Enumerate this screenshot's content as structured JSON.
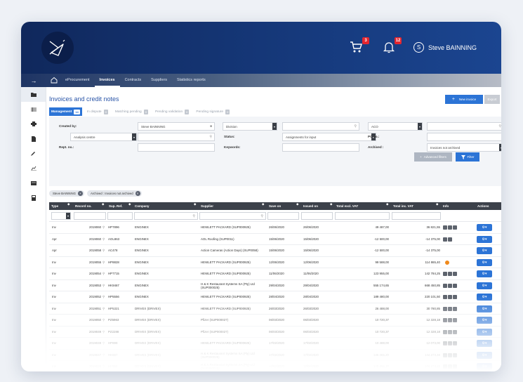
{
  "header": {
    "cart_badge": "3",
    "bell_badge": "12",
    "user_initial": "S",
    "user_name": "Steve BAINNING"
  },
  "nav": {
    "items": [
      {
        "label": "eProcurement",
        "active": false
      },
      {
        "label": "Invoices",
        "active": true
      },
      {
        "label": "Contracts",
        "active": false
      },
      {
        "label": "Suppliers",
        "active": false
      },
      {
        "label": "Statistics reports",
        "active": false
      }
    ]
  },
  "page": {
    "title": "Invoices and credit notes",
    "new_invoice_label": "New invoice",
    "export_label": "Export"
  },
  "tabs": [
    {
      "label": "Management",
      "count": "14",
      "active": true
    },
    {
      "label": "In dispute",
      "count": "0",
      "active": false
    },
    {
      "label": "Matching pending",
      "count": "0",
      "active": false
    },
    {
      "label": "Pending validation",
      "count": "0",
      "active": false
    },
    {
      "label": "Pending signature",
      "count": "0",
      "active": false
    }
  ],
  "filters": {
    "created_by_label": "Created by:",
    "created_by_value": "Steve BAINNING",
    "division_placeholder": "Division",
    "aco_value": "ACO",
    "analysis_centre_placeholder": "Analysis centre",
    "status_label": "Status:",
    "status_value": "Assignments for input",
    "po_label": "PO no.:",
    "rept_label": "Rept. no.:",
    "keywords_label": "Keywords:",
    "archived_label": "Archived :",
    "archived_value": "Invoices not archived",
    "advanced_label": "Advanced filters",
    "filter_label": "Filter"
  },
  "chips": [
    {
      "label": "Steve BAINNING"
    },
    {
      "label": "Archived : Invoices not archived"
    }
  ],
  "table": {
    "headers": {
      "type": "Type",
      "record": "Record no.",
      "sup_ref": "Sup. Ref.",
      "company": "Company",
      "supplier": "Supplier",
      "save_on": "Save on",
      "issued_on": "Issued on",
      "total_excl": "Total excl. VAT",
      "total_inc": "Total inc. VAT",
      "info": "Info",
      "actions": "Actions"
    },
    "rows": [
      {
        "type": "Inv",
        "record": "2019060",
        "sup_ref": "HP7896",
        "company": "ENGINEX",
        "supplier": "HEWLETT PACKARD (SUP000925)",
        "supplier2": "",
        "save_on": "26/06/2020",
        "issued_on": "26/06/2020",
        "total_excl": "49 487,00",
        "total_inc": "36 821,55",
        "info": "boxes3"
      },
      {
        "type": "Apr",
        "record": "2019060",
        "sup_ref": "AOL863",
        "company": "ENGINEX",
        "supplier": "AOL Roofing (SUP0011)",
        "supplier2": "",
        "save_on": "15/06/2020",
        "issued_on": "15/06/2020",
        "total_excl": "-12 500,00",
        "total_inc": "-14 375,00",
        "info": "boxes2"
      },
      {
        "type": "Apr",
        "record": "2019058",
        "sup_ref": "AC478",
        "company": "ENGINEX",
        "supplier": "Action Cameras (Action Days) (SUP0058)",
        "supplier2": "",
        "save_on": "15/06/2020",
        "issued_on": "15/06/2020",
        "total_excl": "-12 500,00",
        "total_inc": "-14 375,00",
        "info": "none"
      },
      {
        "type": "Inv",
        "record": "2019055",
        "sup_ref": "HP8828",
        "company": "ENGINEX",
        "supplier": "HEWLETT PACKARD (SUP000925)",
        "supplier2": "",
        "save_on": "12/06/2020",
        "issued_on": "12/06/2020",
        "total_excl": "99 588,00",
        "total_inc": "114 865,40",
        "info": "dot"
      },
      {
        "type": "Inv",
        "record": "2019054",
        "sup_ref": "HP7715",
        "company": "ENGINEX",
        "supplier": "HEWLETT PACKARD (SUP000925)",
        "supplier2": "",
        "save_on": "11/06/2020",
        "issued_on": "11/06/2020",
        "total_excl": "123 955,00",
        "total_inc": "142 784,25",
        "info": "boxes3"
      },
      {
        "type": "Inv",
        "record": "2019053",
        "sup_ref": "HK9467",
        "company": "ENGINEX",
        "supplier": "H & K Restaurant Systems SA (Pty) Ltd",
        "supplier2": "(SUP000025)",
        "save_on": "29/04/2020",
        "issued_on": "29/04/2020",
        "total_excl": "555 174,65",
        "total_inc": "668 450,85",
        "info": "boxes3"
      },
      {
        "type": "Inv",
        "record": "2019052",
        "sup_ref": "HP5556",
        "company": "ENGINEX",
        "supplier": "HEWLETT PACKARD (SUP000925)",
        "supplier2": "",
        "save_on": "28/04/2020",
        "issued_on": "28/04/2020",
        "total_excl": "189 480,00",
        "total_inc": "220 101,50",
        "info": "boxes3"
      },
      {
        "type": "Inv",
        "record": "2019051",
        "sup_ref": "HP5321",
        "company": "DRIVEX (DRIVEX)",
        "supplier": "HEWLETT PACKARD (SUP000925)",
        "supplier2": "",
        "save_on": "26/03/2020",
        "issued_on": "26/03/2020",
        "total_excl": "26 488,00",
        "total_inc": "30 780,85",
        "info": "boxes3"
      },
      {
        "type": "Inv",
        "record": "2019050",
        "sup_ref": "PZ5963",
        "company": "DRIVEX (DRIVEX)",
        "supplier": "Pfizer (SUP000027)",
        "supplier2": "",
        "save_on": "06/03/2020",
        "issued_on": "06/03/2020",
        "total_excl": "10 720,37",
        "total_inc": "12 328,18",
        "info": "boxes3"
      },
      {
        "type": "Inv",
        "record": "2019049",
        "sup_ref": "PZ2288",
        "company": "DRIVEX (DRIVEX)",
        "supplier": "Pfizer (SUP000027)",
        "supplier2": "",
        "save_on": "06/03/2020",
        "issued_on": "06/03/2020",
        "total_excl": "10 720,37",
        "total_inc": "12 328,18",
        "info": "boxes3"
      },
      {
        "type": "Inv",
        "record": "2019048",
        "sup_ref": "HP899",
        "company": "DRIVEX (DRIVEX)",
        "supplier": "HEWLETT PACKARD (SUP000925)",
        "supplier2": "",
        "save_on": "17/02/2020",
        "issued_on": "17/02/2020",
        "total_excl": "10 488,00",
        "total_inc": "12 073,00",
        "info": "boxes3"
      },
      {
        "type": "Inv",
        "record": "2019047",
        "sup_ref": "HK667",
        "company": "DRIVEX (DRIVEX)",
        "supplier": "H & K Restaurant Systems SA (Pty) Ltd",
        "supplier2": "(SUP000025)",
        "save_on": "17/02/2020",
        "issued_on": "17/02/2020",
        "total_excl": "125 455,20",
        "total_inc": "144 273,48",
        "info": "boxes3"
      },
      {
        "type": "Inv",
        "record": "2019046",
        "sup_ref": "HK558",
        "company": "DRIVEX (DRIVEX)",
        "supplier": "H & K Restaurant Systems SA (Pty) Ltd",
        "supplier2": "(SUP000025)",
        "save_on": "17/02/2020",
        "issued_on": "17/02/2020",
        "total_excl": "125 455,20",
        "total_inc": "144 273,48",
        "info": "boxes3"
      }
    ]
  },
  "colors": {
    "brand_blue": "#2c74d6",
    "header_navy": "#10285c",
    "table_header": "#3c414a",
    "warning_orange": "#f08a1c",
    "badge_red": "#e4262f"
  }
}
